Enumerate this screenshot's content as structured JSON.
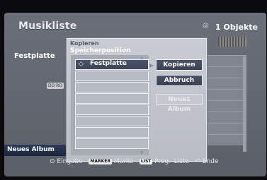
{
  "header": {
    "title": "Musikliste",
    "count": "1 Objekte"
  },
  "left_panel": {
    "label": "Festplatte",
    "tag": "DD RD",
    "new_album": "Neues Album"
  },
  "dialog": {
    "title": "Kopieren",
    "subtitle": "Speicherposition",
    "list": {
      "selected_item": "Festplatte",
      "items": [
        "Festplatte",
        "",
        "",
        "",
        "",
        "",
        "",
        "",
        "",
        ""
      ]
    },
    "buttons": {
      "copy": "Kopieren",
      "cancel": "Abbruch",
      "new_album": "Neues Album"
    }
  },
  "footer": {
    "enter": "Eingabe",
    "marker_key": "MARKER",
    "marker_label": "Marke",
    "list_key": "LIST",
    "list_label": "Prog.–Liste",
    "end_label": "Ende"
  },
  "colors": {
    "dialog_bg": "#c9ccd3",
    "button_active": "#394155",
    "screen_bg": "#6b6f79"
  },
  "icons": {
    "disc": "disc-icon",
    "selected_item_icon": "hdd-icon",
    "enter": "ok-icon",
    "return": "return-icon"
  }
}
